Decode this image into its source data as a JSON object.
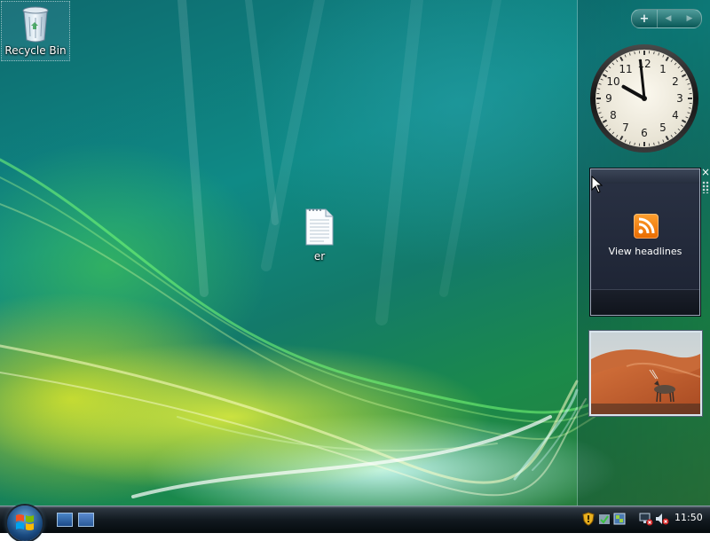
{
  "desktop": {
    "icons": [
      {
        "label": "Recycle Bin",
        "icon": "recycle-bin-icon"
      },
      {
        "label": "er",
        "icon": "text-document-icon"
      }
    ]
  },
  "sidebar": {
    "controls": {
      "add": "+",
      "prev": "◀",
      "next": "▶"
    },
    "clock": {
      "hour": 9,
      "minute": 59,
      "numerals": [
        "12",
        "1",
        "2",
        "3",
        "4",
        "5",
        "6",
        "7",
        "8",
        "9",
        "10",
        "11"
      ]
    },
    "feed_gadget": {
      "link_text": "View headlines",
      "close": "×"
    },
    "slideshow": {
      "subject": "oryx-in-desert-photo"
    }
  },
  "taskbar": {
    "clock": "11:50",
    "quick_launch": [
      "show-desktop-icon",
      "switch-windows-icon"
    ],
    "tray_icons": [
      "security-shield-icon",
      "windows-defender-icon",
      "network-icon",
      "volume-muted-icon"
    ]
  },
  "colors": {
    "accent": "#0f8a86",
    "rss": "#f08010",
    "taskbar": "#121a20"
  }
}
